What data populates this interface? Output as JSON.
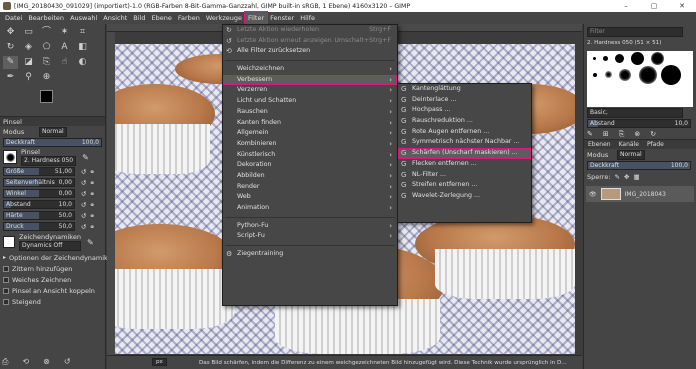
{
  "window": {
    "title": "[IMG_20180430_091029] (importiert)-1.0 (RGB-Farben 8-Bit-Gamma-Ganzzahl, GIMP built-in sRGB, 1 Ebene) 4160x3120 – GIMP",
    "minimize": "–",
    "maximize": "▢",
    "close": "✕"
  },
  "menubar": [
    "Datei",
    "Bearbeiten",
    "Auswahl",
    "Ansicht",
    "Bild",
    "Ebene",
    "Farben",
    "Werkzeuge",
    "Filter",
    "Fenster",
    "Hilfe"
  ],
  "filter_menu": {
    "repeat_last": "Letzte Aktion wiederholen",
    "repeat_last_shortcut": "Strg+F",
    "reshow_last": "Letzte Aktion erneut anzeigen",
    "reshow_last_shortcut": "Umschalt+Strg+F",
    "reset_all": "Alle Filter zurücksetzen",
    "items": [
      "Weichzeichnen",
      "Verbessern",
      "Verzerren",
      "Licht und Schatten",
      "Rauschen",
      "Kanten finden",
      "Allgemein",
      "Kombinieren",
      "Künstlerisch",
      "Dekoration",
      "Abbilden",
      "Render",
      "Web",
      "Animation"
    ],
    "python": "Python-Fu",
    "script": "Script-Fu",
    "zieg": "Ziegentraining"
  },
  "enhance_menu": {
    "items": [
      "Kantenglättung",
      "Deinterlace ...",
      "Hochpass ...",
      "Rauschreduktion ...",
      "Rote Augen entfernen ...",
      "Symmetrisch nächster Nachbar ...",
      "Schärfen (Unscharf maskieren) ...",
      "Flecken entfernen ...",
      "NL-Filter ...",
      "Streifen entfernen ...",
      "Wavelet-Zerlegung ..."
    ]
  },
  "tool_options": {
    "panel": "Pinsel",
    "mode_label": "Modus",
    "mode_value": "Normal",
    "opacity_label": "Deckkraft",
    "opacity_value": "100,0",
    "brush_label": "Pinsel",
    "brush_value": "2. Hardness 050",
    "size": {
      "label": "Größe",
      "value": "51,00",
      "fraction": 0.5
    },
    "ratio": {
      "label": "Seitenverhältnis",
      "value": "0,00",
      "fraction": 0.5
    },
    "angle": {
      "label": "Winkel",
      "value": "0,00",
      "fraction": 0.5
    },
    "spacing": {
      "label": "Abstand",
      "value": "10,0",
      "fraction": 0.1
    },
    "hardness": {
      "label": "Härte",
      "value": "50,0",
      "fraction": 0.5
    },
    "pressure": {
      "label": "Druck",
      "value": "50,0",
      "fraction": 0.5
    },
    "dynamics_label": "Zeichendynamiken",
    "dynamics_value": "Dynamics Off",
    "opt_dynamics": "Optionen der Zeichendynamik",
    "opt_jitter": "Zittern hinzufügen",
    "opt_smooth": "Weiches Zeichnen",
    "opt_lock": "Pinsel an Ansicht koppeln",
    "opt_incremental": "Steigend"
  },
  "dock": {
    "filter_placeholder": "Filter",
    "brush_name": "2. Hardness 050 (51 × 51)",
    "basic": "Basic,",
    "spacing_label": "Abstand",
    "spacing_value": "10,0",
    "tabs": [
      "Ebenen",
      "Kanäle",
      "Pfade"
    ],
    "mode_label": "Modus",
    "mode_value": "Normal",
    "opacity_label": "Deckkraft",
    "opacity_value": "100,0",
    "lock_label": "Sperre:",
    "layer_name": "IMG_2018043"
  },
  "status": {
    "unit": "px",
    "message": "Das Bild schärfen, indem die Differenz zu einem weichgezeichneten Bild hinzugefügt wird. Diese Technik wurde ursprünglich in D..."
  }
}
